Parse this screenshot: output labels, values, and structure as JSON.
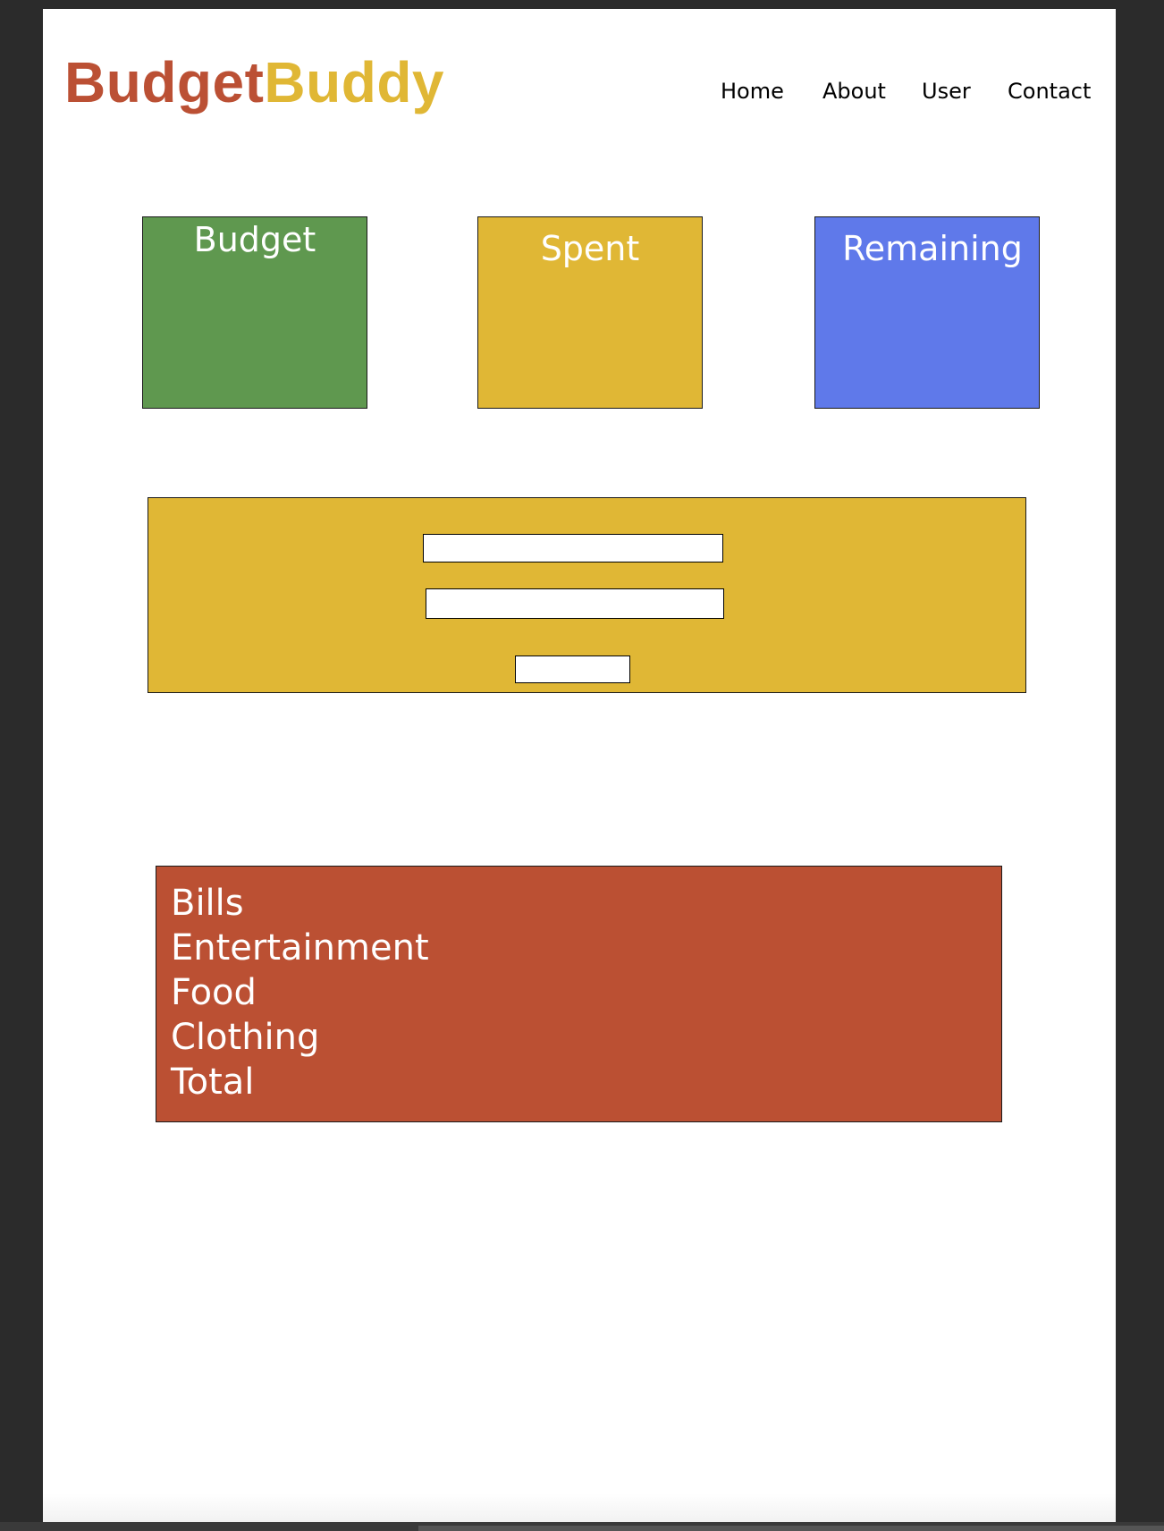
{
  "brand": {
    "name_part1": "Budget",
    "name_part2": "Buddy",
    "color_part1": "#bb5034",
    "color_part2": "#e0b735"
  },
  "nav": {
    "items": [
      {
        "label": "Home"
      },
      {
        "label": "About"
      },
      {
        "label": "User"
      },
      {
        "label": "Contact"
      }
    ]
  },
  "summary": {
    "cards": [
      {
        "title": "Budget",
        "color": "#5f984f"
      },
      {
        "title": "Spent",
        "color": "#e0b735"
      },
      {
        "title": "Remaining",
        "color": "#5f79ea"
      }
    ]
  },
  "form": {
    "panel_color": "#e0b735",
    "field1_value": "",
    "field2_value": "",
    "submit_label": ""
  },
  "categories": {
    "panel_color": "#bb5033",
    "items": [
      "Bills",
      "Entertainment",
      "Food",
      "Clothing",
      "Total"
    ]
  }
}
